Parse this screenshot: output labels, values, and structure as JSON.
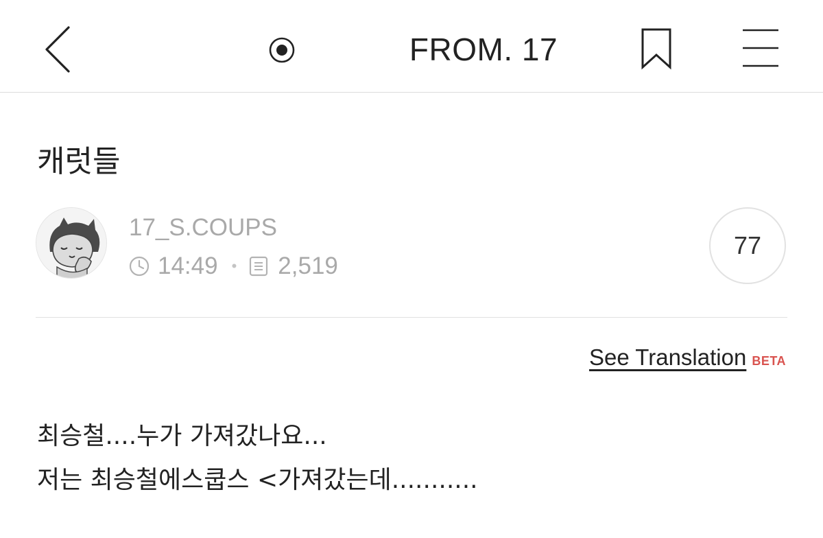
{
  "header": {
    "title": "FROM. 17",
    "icons": {
      "back": "back-chevron-icon",
      "radio": "radio-target-icon",
      "bookmark": "bookmark-icon",
      "menu": "hamburger-menu-icon"
    }
  },
  "post": {
    "title": "캐럿들",
    "author": "17_S.COUPS",
    "time": "14:49",
    "views": "2,519",
    "comment_count": "77",
    "translate_label": "See Translation",
    "beta_label": "BETA",
    "body_lines": [
      "최승철....누가 가져갔나요...",
      "저는 최승철에스쿱스 <가져갔는데..........."
    ]
  },
  "colors": {
    "text": "#222222",
    "muted": "#a9a9a9",
    "divider": "#e0e0e0",
    "beta": "#d9534f"
  }
}
